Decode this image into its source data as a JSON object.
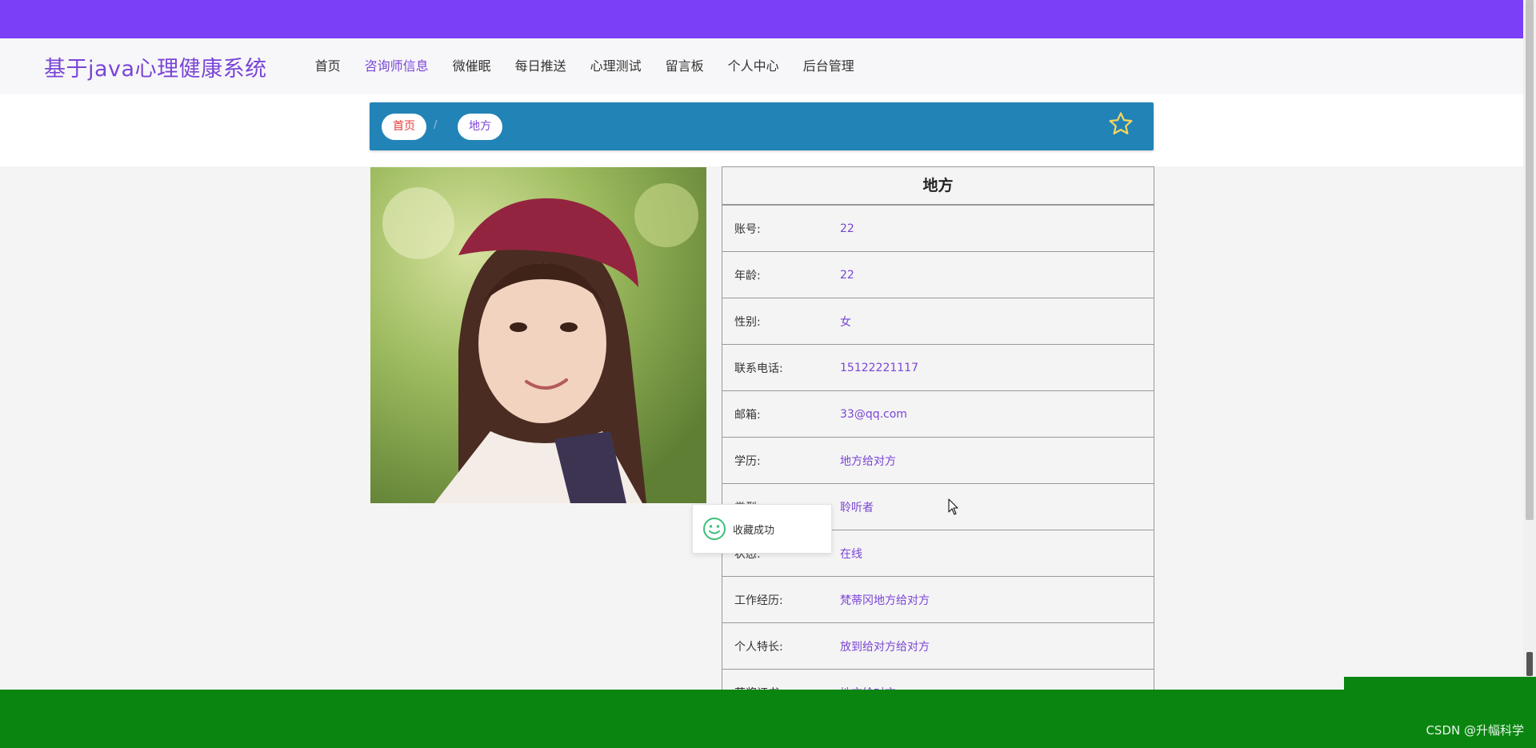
{
  "header": {
    "brand": "基于java心理健康系统",
    "nav": [
      {
        "label": "首页",
        "active": false
      },
      {
        "label": "咨询师信息",
        "active": true
      },
      {
        "label": "微催眠",
        "active": false
      },
      {
        "label": "每日推送",
        "active": false
      },
      {
        "label": "心理测试",
        "active": false
      },
      {
        "label": "留言板",
        "active": false
      },
      {
        "label": "个人中心",
        "active": false
      },
      {
        "label": "后台管理",
        "active": false
      }
    ]
  },
  "breadcrumb": {
    "home": "首页",
    "separator": "/",
    "current": "地方",
    "favorite_icon": "star-outline-icon"
  },
  "detail": {
    "title": "地方",
    "rows": [
      {
        "label": "账号:",
        "value": "22"
      },
      {
        "label": "年龄:",
        "value": "22"
      },
      {
        "label": "性别:",
        "value": "女"
      },
      {
        "label": "联系电话:",
        "value": "15122221117"
      },
      {
        "label": "邮箱:",
        "value": "33@qq.com"
      },
      {
        "label": "学历:",
        "value": "地方给对方"
      },
      {
        "label": "类型:",
        "value": "聆听者"
      },
      {
        "label": "状态:",
        "value": "在线"
      },
      {
        "label": "工作经历:",
        "value": "梵蒂冈地方给对方"
      },
      {
        "label": "个人特长:",
        "value": "放到给对方给对方"
      },
      {
        "label": "获奖证书:",
        "value": "地方给对方"
      }
    ]
  },
  "toast": {
    "text": "收藏成功",
    "icon": "smile-icon"
  },
  "watermark": "CSDN @升幅科学",
  "colors": {
    "topbar": "#7a3ff7",
    "accent": "#7a45d6",
    "crumb_bar": "#2283b7",
    "bottom_bar": "#0a8610"
  }
}
